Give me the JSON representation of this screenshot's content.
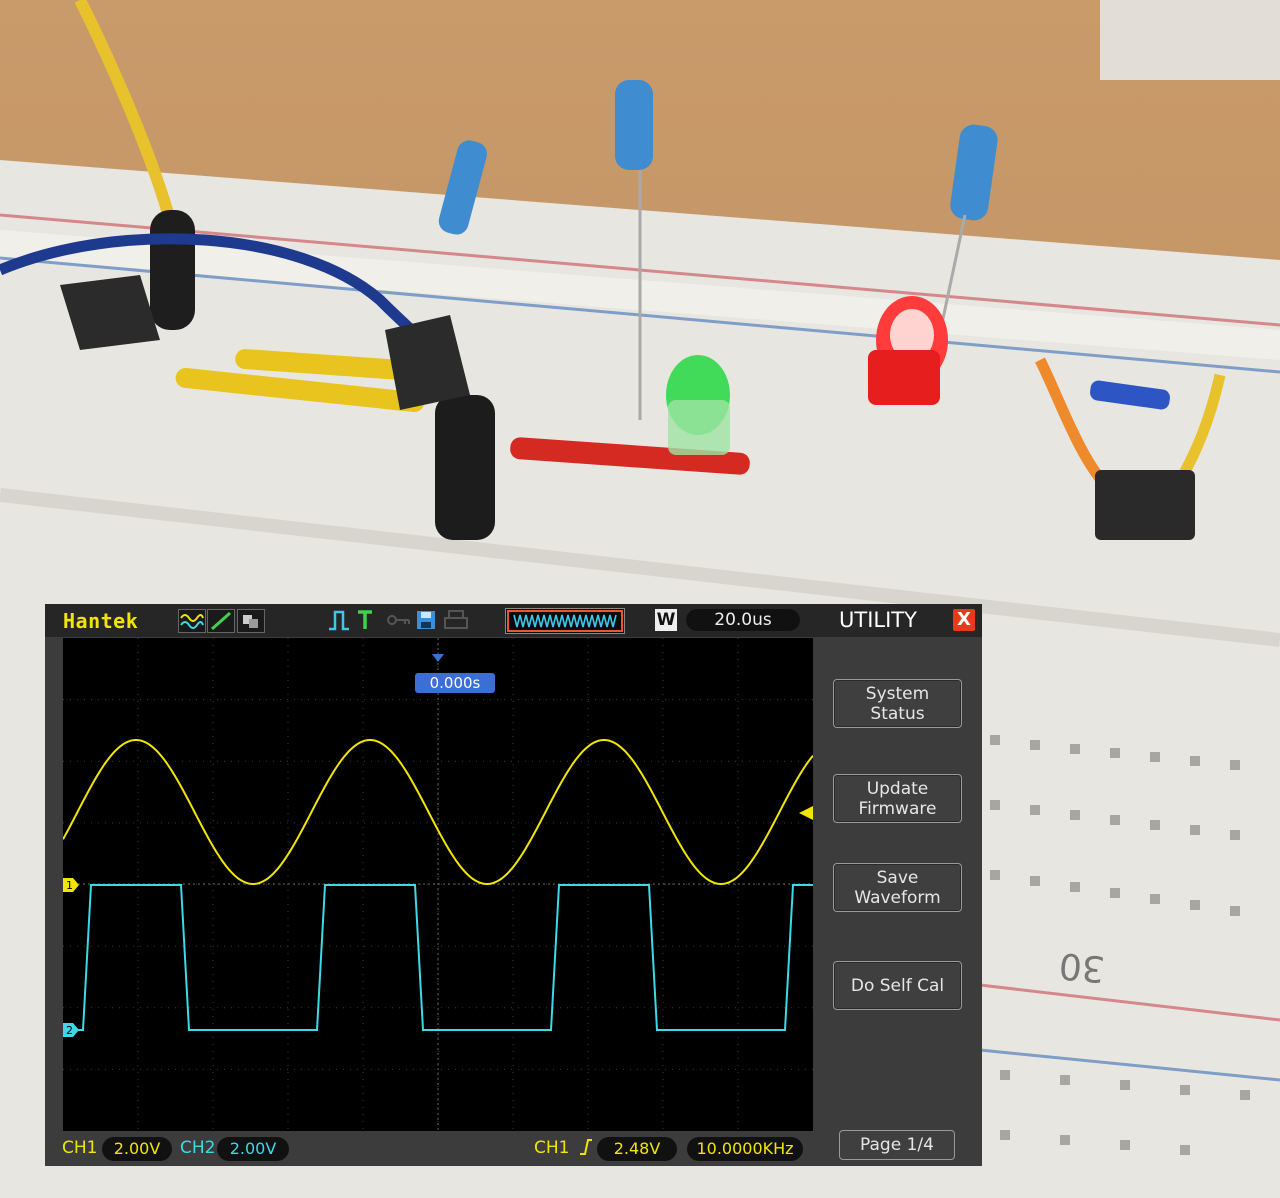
{
  "scope": {
    "brand": "Hantek",
    "timebase": "20.0us",
    "w_badge": "W",
    "trigger_position": "0.000s",
    "menu": {
      "title": "UTILITY",
      "close": "X",
      "buttons": [
        {
          "line1": "System",
          "line2": "Status"
        },
        {
          "line1": "Update",
          "line2": "Firmware"
        },
        {
          "line1": "Save",
          "line2": "Waveform"
        },
        {
          "line1": "Do Self Cal",
          "line2": ""
        }
      ],
      "page": "Page 1/4"
    },
    "status": {
      "ch1_label": "CH1",
      "ch1_scale": "2.00V",
      "ch2_label": "CH2",
      "ch2_scale": "2.00V",
      "trigger_source": "CH1",
      "trigger_level": "2.48V",
      "frequency": "10.0000KHz"
    },
    "markers": {
      "ch1": "1",
      "ch2": "2"
    },
    "colors": {
      "ch1": "#f2e600",
      "ch2": "#3cd9e6",
      "accent": "#3b6fd6"
    }
  },
  "chart_data": [
    {
      "type": "line",
      "series": [
        {
          "name": "CH1",
          "shape": "sine",
          "cycles_visible": 3.2,
          "color": "#f2e600"
        },
        {
          "name": "CH2",
          "shape": "square",
          "cycles_visible": 3.2,
          "color": "#3cd9e6"
        }
      ],
      "grid": true
    }
  ]
}
